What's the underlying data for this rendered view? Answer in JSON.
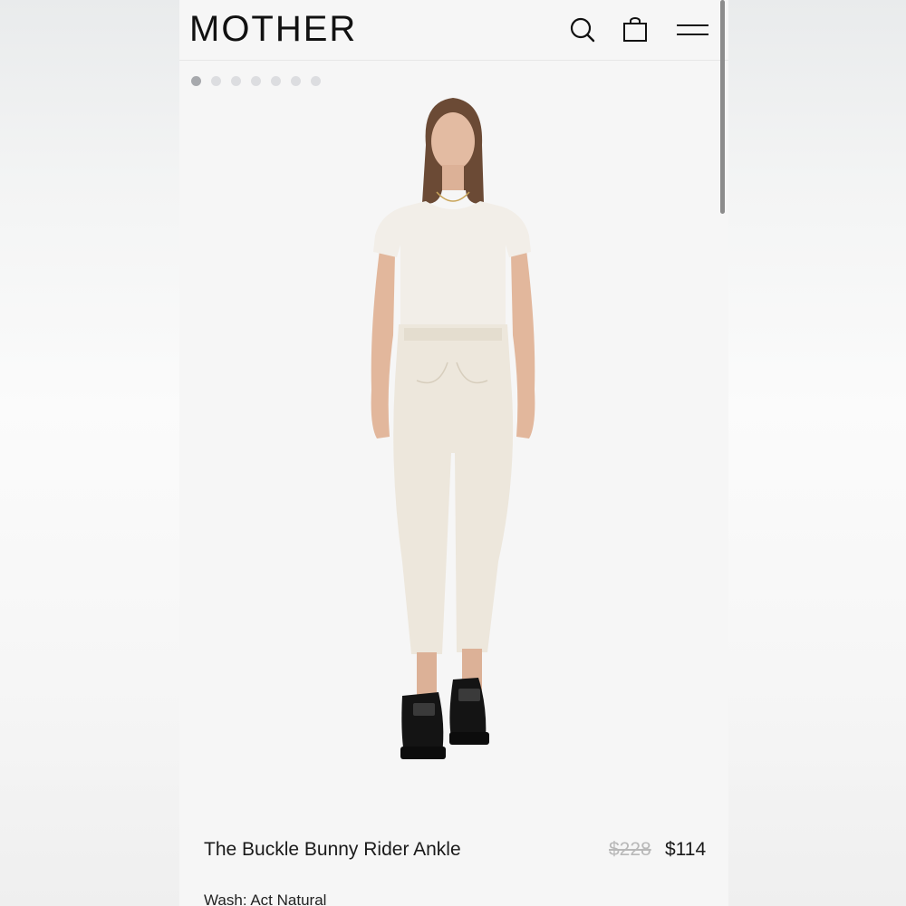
{
  "brand": {
    "logo_text": "MOTHER"
  },
  "header": {
    "icons": [
      "search-icon",
      "shopping-bag-icon",
      "hamburger-menu-icon"
    ]
  },
  "gallery": {
    "total_images": 7,
    "active_index": 0
  },
  "product": {
    "name": "The Buckle Bunny Rider Ankle",
    "original_price": "$228",
    "sale_price": "$114",
    "wash_label": "Wash: Act Natural"
  },
  "colors": {
    "background": "#f6f6f6",
    "text": "#1a1a1a",
    "strike_price": "#b8b8b8",
    "dot_active": "#a7a9ad",
    "dot_inactive": "#dcdde0"
  }
}
